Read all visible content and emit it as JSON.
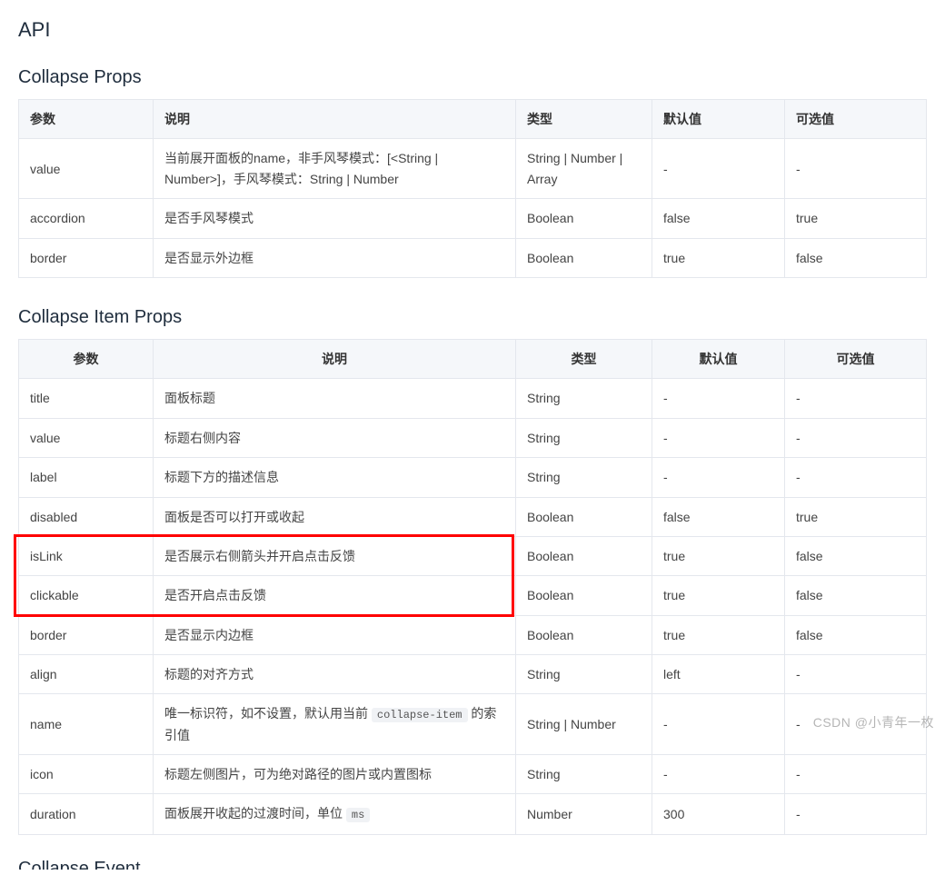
{
  "api_title": "API",
  "collapse_props": {
    "title": "Collapse Props",
    "headers": [
      "参数",
      "说明",
      "类型",
      "默认值",
      "可选值"
    ],
    "rows": [
      {
        "param": "value",
        "desc": "当前展开面板的name，非手风琴模式：[<String | Number>]，手风琴模式：String | Number",
        "type": "String | Number | Array",
        "default": "-",
        "opt": "-"
      },
      {
        "param": "accordion",
        "desc": "是否手风琴模式",
        "type": "Boolean",
        "default": "false",
        "opt": "true"
      },
      {
        "param": "border",
        "desc": "是否显示外边框",
        "type": "Boolean",
        "default": "true",
        "opt": "false"
      }
    ]
  },
  "collapse_item_props": {
    "title": "Collapse Item Props",
    "headers": [
      "参数",
      "说明",
      "类型",
      "默认值",
      "可选值"
    ],
    "rows": [
      {
        "param": "title",
        "desc": "面板标题",
        "type": "String",
        "default": "-",
        "opt": "-"
      },
      {
        "param": "value",
        "desc": "标题右侧内容",
        "type": "String",
        "default": "-",
        "opt": "-"
      },
      {
        "param": "label",
        "desc": "标题下方的描述信息",
        "type": "String",
        "default": "-",
        "opt": "-"
      },
      {
        "param": "disabled",
        "desc": "面板是否可以打开或收起",
        "type": "Boolean",
        "default": "false",
        "opt": "true"
      },
      {
        "param": "isLink",
        "desc": "是否展示右侧箭头并开启点击反馈",
        "type": "Boolean",
        "default": "true",
        "opt": "false",
        "highlight": true
      },
      {
        "param": "clickable",
        "desc": "是否开启点击反馈",
        "type": "Boolean",
        "default": "true",
        "opt": "false",
        "highlight": true
      },
      {
        "param": "border",
        "desc": "是否显示内边框",
        "type": "Boolean",
        "default": "true",
        "opt": "false"
      },
      {
        "param": "align",
        "desc": "标题的对齐方式",
        "type": "String",
        "default": "left",
        "opt": "-"
      },
      {
        "param": "name",
        "desc_pre": "唯一标识符，如不设置，默认用当前 ",
        "desc_code": "collapse-item",
        "desc_post": " 的索引值",
        "type": "String | Number",
        "default": "-",
        "opt": "-"
      },
      {
        "param": "icon",
        "desc": "标题左侧图片，可为绝对路径的图片或内置图标",
        "type": "String",
        "default": "-",
        "opt": "-"
      },
      {
        "param": "duration",
        "desc_pre": "面板展开收起的过渡时间，单位 ",
        "desc_code": "ms",
        "desc_post": "",
        "type": "Number",
        "default": "300",
        "opt": "-"
      }
    ]
  },
  "collapse_event": {
    "title": "Collapse Event"
  },
  "watermark": "CSDN @小青年一枚"
}
